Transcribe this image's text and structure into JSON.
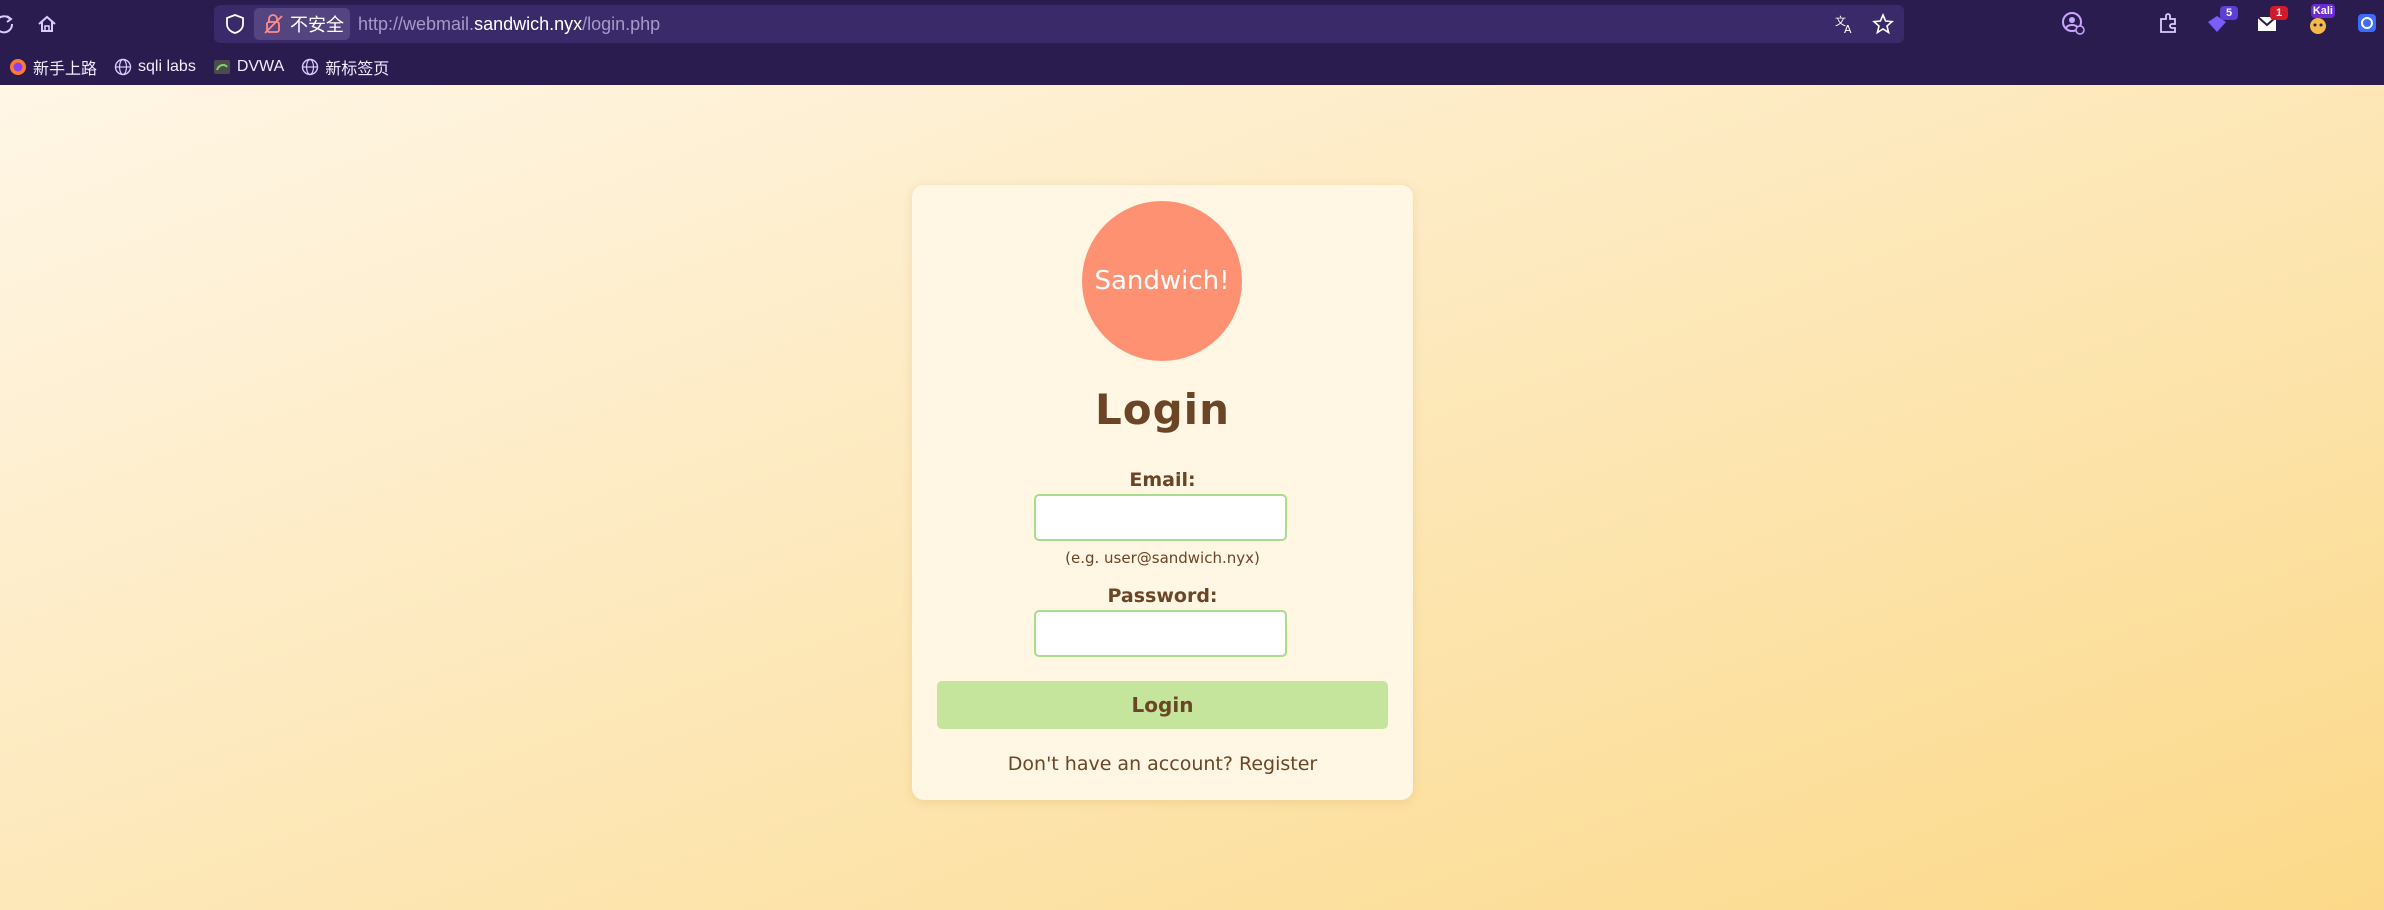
{
  "browser": {
    "insecure_label": "不安全",
    "url": {
      "scheme_prefix": "http://webmail.",
      "host": "sandwich.nyx",
      "path": "/login.php"
    },
    "bookmarks": [
      {
        "label": "新手上路",
        "icon": "firefox-icon"
      },
      {
        "label": "sqli labs",
        "icon": "globe-icon"
      },
      {
        "label": "DVWA",
        "icon": "dvwa-icon"
      },
      {
        "label": "新标签页",
        "icon": "globe-icon"
      }
    ],
    "extensions": {
      "badge_5": "5",
      "badge_1": "1",
      "profile_label": "Kali"
    },
    "colors": {
      "chrome_bg": "#2b1c4f",
      "urlbar_bg": "#3a2a6a"
    }
  },
  "login": {
    "logo_text": "Sandwich!",
    "title": "Login",
    "email_label": "Email:",
    "email_value": "",
    "email_hint": "(e.g. user@sandwich.nyx)",
    "password_label": "Password:",
    "password_value": "",
    "submit_label": "Login",
    "footer_text": "Don't have an account?",
    "register_link": "Register",
    "colors": {
      "logo": "#ff9173",
      "button": "#c4e59b",
      "text": "#6b4526",
      "field_border": "#a9dd8b"
    }
  }
}
